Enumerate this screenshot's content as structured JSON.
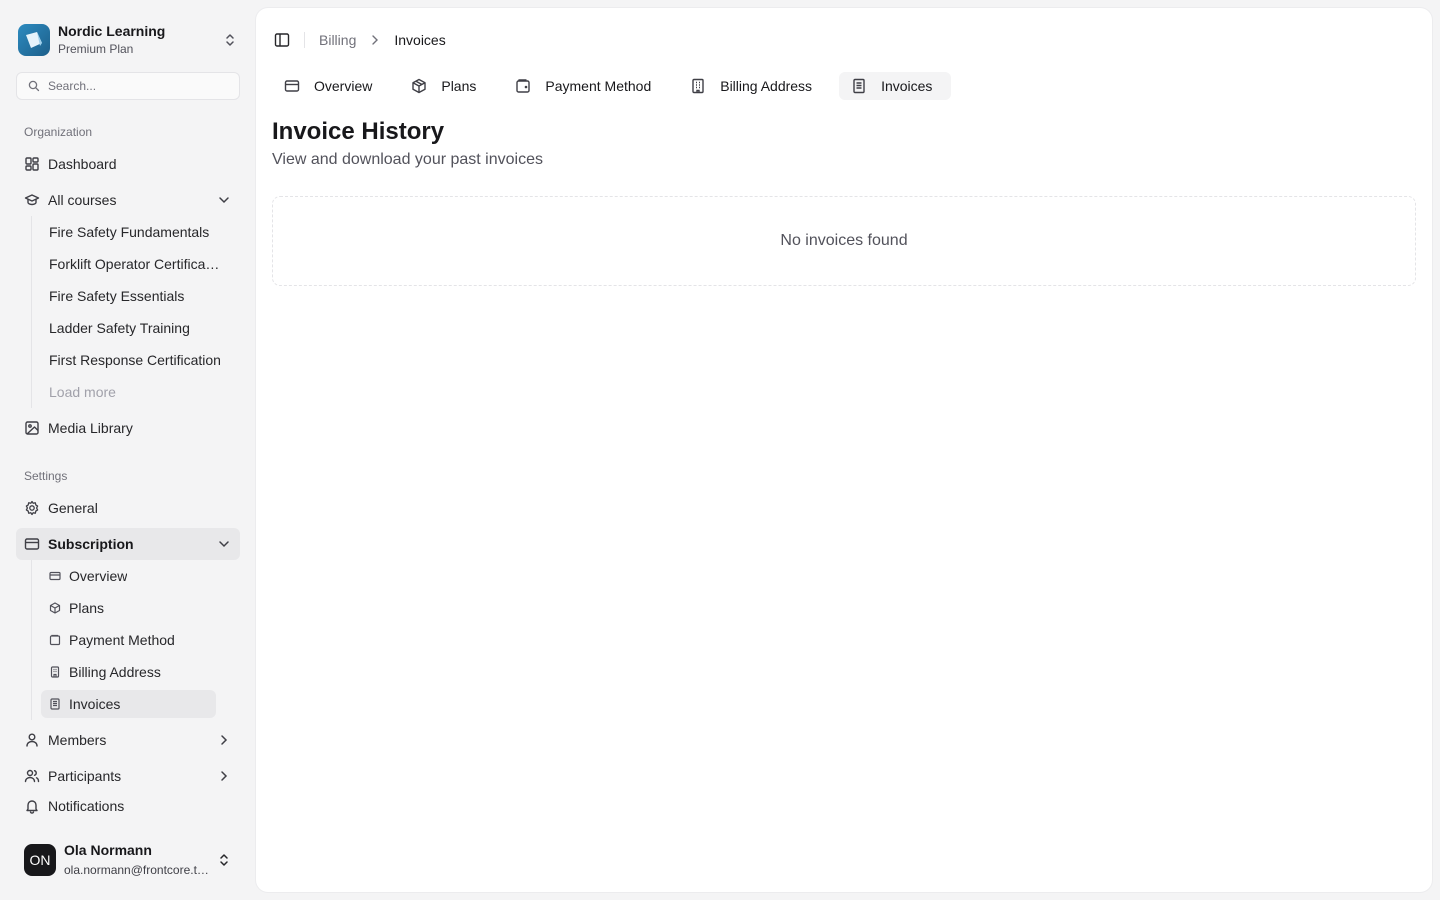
{
  "org": {
    "name": "Nordic Learning",
    "plan": "Premium Plan"
  },
  "search": {
    "placeholder": "Search..."
  },
  "sidebar": {
    "org_group_label": "Organization",
    "dashboard": "Dashboard",
    "all_courses": "All courses",
    "courses": [
      "Fire Safety Fundamentals",
      "Forklift Operator Certification",
      "Fire Safety Essentials",
      "Ladder Safety Training",
      "First Response Certification"
    ],
    "load_more": "Load more",
    "media_library": "Media Library",
    "settings_group_label": "Settings",
    "general": "General",
    "subscription": "Subscription",
    "subscription_items": [
      "Overview",
      "Plans",
      "Payment Method",
      "Billing Address",
      "Invoices"
    ],
    "members": "Members",
    "participants": "Participants",
    "notifications": "Notifications"
  },
  "user": {
    "initials": "ON",
    "name": "Ola Normann",
    "email": "ola.normann@frontcore.tech"
  },
  "breadcrumb": {
    "parent": "Billing",
    "current": "Invoices"
  },
  "tabs": [
    {
      "label": "Overview",
      "icon": "credit-card-icon"
    },
    {
      "label": "Plans",
      "icon": "package-icon"
    },
    {
      "label": "Payment Method",
      "icon": "wallet-icon"
    },
    {
      "label": "Billing Address",
      "icon": "building-icon"
    },
    {
      "label": "Invoices",
      "icon": "file-text-icon",
      "active": true
    }
  ],
  "page": {
    "title": "Invoice History",
    "subtitle": "View and download your past invoices",
    "empty_message": "No invoices found"
  },
  "colors": {
    "background": "#f4f4f5",
    "surface": "#ffffff",
    "active_item": "#e8e8ea",
    "text": "#18181b",
    "muted": "#71717a"
  }
}
